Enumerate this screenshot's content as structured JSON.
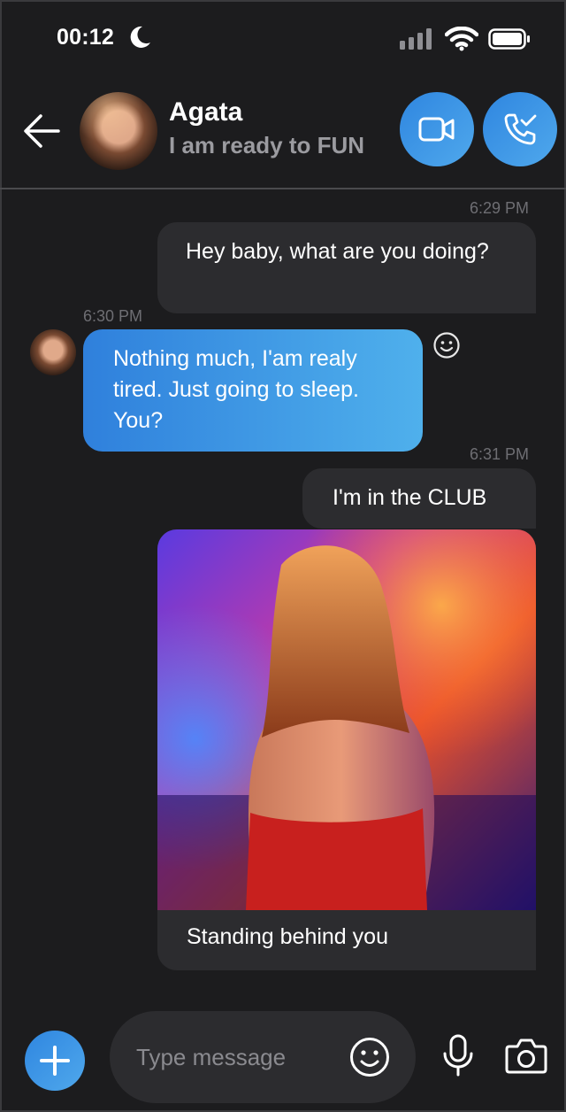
{
  "status_bar": {
    "time": "00:12"
  },
  "header": {
    "contact_name": "Agata",
    "contact_status": "I am ready to FUN"
  },
  "messages": [
    {
      "time": "6:29 PM",
      "text": "Hey baby, what are you doing?",
      "direction": "outgoing"
    },
    {
      "time": "6:30 PM",
      "text": "Nothing much, I'am realy tired. Just going to sleep. You?",
      "direction": "incoming"
    },
    {
      "time": "6:31 PM",
      "text": "I'm in the CLUB",
      "direction": "outgoing"
    },
    {
      "caption": "Standing behind you",
      "direction": "outgoing",
      "type": "photo"
    }
  ],
  "composer": {
    "placeholder": "Type message"
  },
  "colors": {
    "accent": "#3a95e6",
    "background": "#1c1c1e",
    "bubble_outgoing": "#2c2c2f",
    "muted_text": "#9b9ba0"
  }
}
